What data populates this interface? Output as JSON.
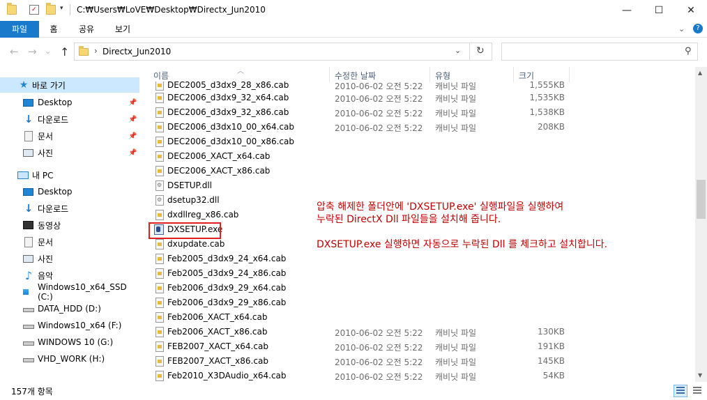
{
  "window": {
    "path": "C:₩Users₩LoVE₩Desktop₩Directx_Jun2010",
    "minimize": "—",
    "maximize": "☐",
    "close": "✕"
  },
  "ribbon": {
    "tabs": [
      "파일",
      "홈",
      "공유",
      "보기"
    ],
    "help": "?"
  },
  "navbar": {
    "back": "←",
    "forward": "→",
    "recent": "⌄",
    "up": "↑",
    "breadcrumb": [
      "Directx_Jun2010"
    ],
    "refresh": "↻",
    "search_placeholder": "",
    "search_icon": "⚲"
  },
  "sidebar": {
    "quick_access": "바로 가기",
    "quick_items": [
      {
        "label": "Desktop",
        "icon": "desktop-icon",
        "pinned": true
      },
      {
        "label": "다운로드",
        "icon": "download-icon",
        "pinned": true
      },
      {
        "label": "문서",
        "icon": "document-icon",
        "pinned": true
      },
      {
        "label": "사진",
        "icon": "picture-icon",
        "pinned": true
      }
    ],
    "this_pc": "내 PC",
    "pc_items": [
      {
        "label": "Desktop",
        "icon": "desktop-icon"
      },
      {
        "label": "다운로드",
        "icon": "download-icon"
      },
      {
        "label": "동영상",
        "icon": "video-icon"
      },
      {
        "label": "문서",
        "icon": "document-icon"
      },
      {
        "label": "사진",
        "icon": "picture-icon"
      },
      {
        "label": "음악",
        "icon": "music-icon"
      },
      {
        "label": "Windows10_x64_SSD (C:)",
        "icon": "windows-drive-icon"
      },
      {
        "label": "DATA_HDD (D:)",
        "icon": "drive-icon"
      },
      {
        "label": "Windows10_x64 (F:)",
        "icon": "drive-icon"
      },
      {
        "label": "WINDOWS 10 (G:)",
        "icon": "drive-icon"
      },
      {
        "label": "VHD_WORK (H:)",
        "icon": "drive-icon"
      }
    ]
  },
  "columns": {
    "name": "이름",
    "date": "수정한 날짜",
    "type": "유형",
    "size": "크기"
  },
  "files": [
    {
      "name": "DEC2005_d3dx9_28_x86.cab",
      "date": "2010-06-02 오전 5:22",
      "type": "캐비닛 파일",
      "size": "1,555KB",
      "icon": "cab-icon"
    },
    {
      "name": "DEC2006_d3dx9_32_x64.cab",
      "date": "2010-06-02 오전 5:22",
      "type": "캐비닛 파일",
      "size": "1,535KB",
      "icon": "cab-icon"
    },
    {
      "name": "DEC2006_d3dx9_32_x86.cab",
      "date": "2010-06-02 오전 5:22",
      "type": "캐비닛 파일",
      "size": "1,538KB",
      "icon": "cab-icon"
    },
    {
      "name": "DEC2006_d3dx10_00_x64.cab",
      "date": "2010-06-02 오전 5:22",
      "type": "캐비닛 파일",
      "size": "208KB",
      "icon": "cab-icon"
    },
    {
      "name": "DEC2006_d3dx10_00_x86.cab",
      "date": "",
      "type": "",
      "size": "",
      "icon": "cab-icon"
    },
    {
      "name": "DEC2006_XACT_x64.cab",
      "date": "",
      "type": "",
      "size": "",
      "icon": "cab-icon"
    },
    {
      "name": "DEC2006_XACT_x86.cab",
      "date": "",
      "type": "",
      "size": "",
      "icon": "cab-icon"
    },
    {
      "name": "DSETUP.dll",
      "date": "",
      "type": "",
      "size": "",
      "icon": "dll-icon"
    },
    {
      "name": "dsetup32.dll",
      "date": "",
      "type": "",
      "size": "",
      "icon": "dll-icon"
    },
    {
      "name": "dxdllreg_x86.cab",
      "date": "",
      "type": "",
      "size": "",
      "icon": "cab-icon"
    },
    {
      "name": "DXSETUP.exe",
      "date": "",
      "type": "",
      "size": "",
      "icon": "exe-icon"
    },
    {
      "name": "dxupdate.cab",
      "date": "",
      "type": "",
      "size": "",
      "icon": "cab-icon"
    },
    {
      "name": "Feb2005_d3dx9_24_x64.cab",
      "date": "",
      "type": "",
      "size": "",
      "icon": "cab-icon"
    },
    {
      "name": "Feb2005_d3dx9_24_x86.cab",
      "date": "",
      "type": "",
      "size": "",
      "icon": "cab-icon"
    },
    {
      "name": "Feb2006_d3dx9_29_x64.cab",
      "date": "",
      "type": "",
      "size": "",
      "icon": "cab-icon"
    },
    {
      "name": "Feb2006_d3dx9_29_x86.cab",
      "date": "",
      "type": "",
      "size": "",
      "icon": "cab-icon"
    },
    {
      "name": "Feb2006_XACT_x64.cab",
      "date": "",
      "type": "",
      "size": "",
      "icon": "cab-icon"
    },
    {
      "name": "Feb2006_XACT_x86.cab",
      "date": "2010-06-02 오전 5:22",
      "type": "캐비닛 파일",
      "size": "130KB",
      "icon": "cab-icon"
    },
    {
      "name": "FEB2007_XACT_x64.cab",
      "date": "2010-06-02 오전 5:22",
      "type": "캐비닛 파일",
      "size": "191KB",
      "icon": "cab-icon"
    },
    {
      "name": "FEB2007_XACT_x86.cab",
      "date": "2010-06-02 오전 5:22",
      "type": "캐비닛 파일",
      "size": "145KB",
      "icon": "cab-icon"
    },
    {
      "name": "Feb2010_X3DAudio_x64.cab",
      "date": "2010-06-02 오전 5:22",
      "type": "캐비닛 파일",
      "size": "54KB",
      "icon": "cab-icon"
    }
  ],
  "annotation": {
    "line1": "압축 해제한 폴더안에 'DXSETUP.exe' 실행파일을 실행하여",
    "line2": "누락된 DirectX Dll 파일들을 설치해 줍니다.",
    "line3": "DXSETUP.exe 실행하면 자동으로 누락된 Dll 를 체크하고 설치합니다.",
    "color": "#c00000"
  },
  "status": {
    "item_count": "157개 항목"
  },
  "colors": {
    "accent": "#1979ca",
    "selection": "#cce8ff",
    "highlight_box": "#e02020"
  }
}
